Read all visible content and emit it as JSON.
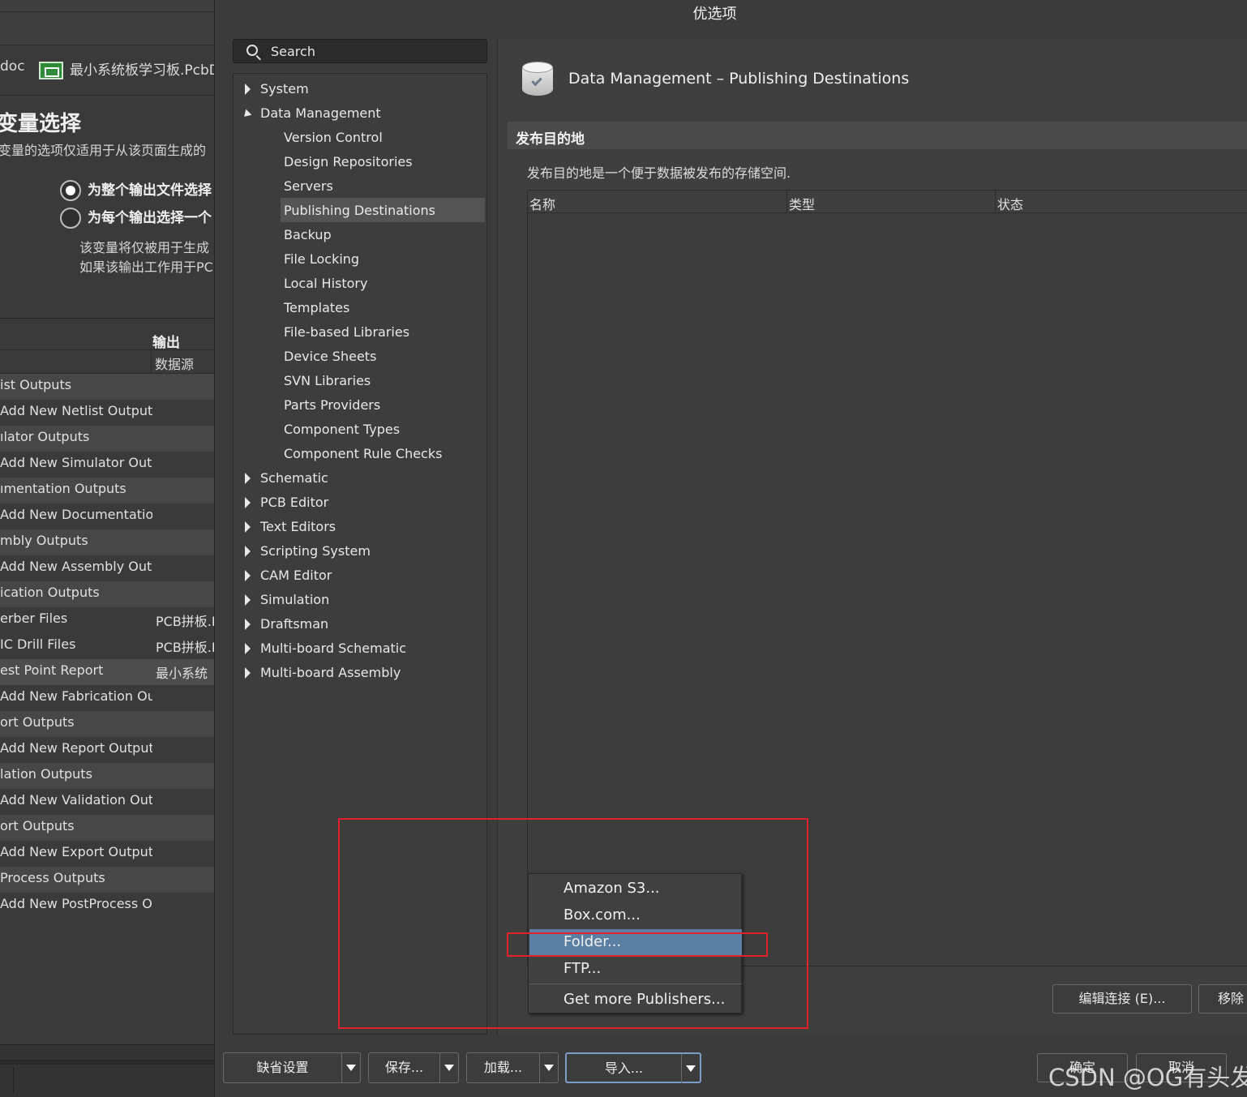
{
  "background_window": {
    "doc_tab_partial": "doc",
    "doc_tab_pcb": "最小系统板学习板.PcbD",
    "heading": "变量选择",
    "description": "变量的选项仅适用于从该页面生成的",
    "radio_whole": "为整个输出文件选择",
    "radio_each": "为每个输出选择一个",
    "note_line1": "该变量将仅被用于生成",
    "note_line2": "如果该输出工作用于PC",
    "column_output": "输出",
    "column_source": "数据源",
    "rows": [
      {
        "label": "ist Outputs",
        "source": ""
      },
      {
        "label": "Add New Netlist Output]",
        "source": ""
      },
      {
        "label": "ılator Outputs",
        "source": ""
      },
      {
        "label": "Add New Simulator Outp",
        "source": ""
      },
      {
        "label": "ımentation Outputs",
        "source": ""
      },
      {
        "label": "Add New Documentation",
        "source": ""
      },
      {
        "label": "mbly Outputs",
        "source": ""
      },
      {
        "label": "Add New Assembly Outpı",
        "source": ""
      },
      {
        "label": "ication Outputs",
        "source": ""
      },
      {
        "label": "erber Files",
        "source": "PCB拼板.I"
      },
      {
        "label": "IC Drill Files",
        "source": "PCB拼板.I"
      },
      {
        "label": "est Point Report",
        "source": "最小系统"
      },
      {
        "label": "Add New Fabrication Out",
        "source": ""
      },
      {
        "label": "ort Outputs",
        "source": ""
      },
      {
        "label": "Add New Report Output]",
        "source": ""
      },
      {
        "label": "lation Outputs",
        "source": ""
      },
      {
        "label": "Add New Validation Outp",
        "source": ""
      },
      {
        "label": "ort Outputs",
        "source": ""
      },
      {
        "label": "Add New Export Output]",
        "source": ""
      },
      {
        "label": "Process Outputs",
        "source": ""
      },
      {
        "label": "Add New PostProcess Ou",
        "source": ""
      }
    ]
  },
  "dialog": {
    "title": "优选项",
    "search": {
      "placeholder": "Search"
    },
    "tree": [
      {
        "label": "System",
        "level": 0,
        "state": "collapsed"
      },
      {
        "label": "Data Management",
        "level": 0,
        "state": "expanded"
      },
      {
        "label": "Version Control",
        "level": 1
      },
      {
        "label": "Design Repositories",
        "level": 1
      },
      {
        "label": "Servers",
        "level": 1
      },
      {
        "label": "Publishing Destinations",
        "level": 1,
        "selected": true
      },
      {
        "label": "Backup",
        "level": 1
      },
      {
        "label": "File Locking",
        "level": 1
      },
      {
        "label": "Local History",
        "level": 1
      },
      {
        "label": "Templates",
        "level": 1
      },
      {
        "label": "File-based Libraries",
        "level": 1
      },
      {
        "label": "Device Sheets",
        "level": 1
      },
      {
        "label": "SVN Libraries",
        "level": 1
      },
      {
        "label": "Parts Providers",
        "level": 1
      },
      {
        "label": "Component Types",
        "level": 1
      },
      {
        "label": "Component Rule Checks",
        "level": 1
      },
      {
        "label": "Schematic",
        "level": 0,
        "state": "collapsed"
      },
      {
        "label": "PCB Editor",
        "level": 0,
        "state": "collapsed"
      },
      {
        "label": "Text Editors",
        "level": 0,
        "state": "collapsed"
      },
      {
        "label": "Scripting System",
        "level": 0,
        "state": "collapsed"
      },
      {
        "label": "CAM Editor",
        "level": 0,
        "state": "collapsed"
      },
      {
        "label": "Simulation",
        "level": 0,
        "state": "collapsed"
      },
      {
        "label": "Draftsman",
        "level": 0,
        "state": "collapsed"
      },
      {
        "label": "Multi-board Schematic",
        "level": 0,
        "state": "collapsed"
      },
      {
        "label": "Multi-board Assembly",
        "level": 0,
        "state": "collapsed"
      }
    ],
    "page_title": "Data Management – Publishing Destinations",
    "section_title": "发布目的地",
    "section_desc": "发布目的地是一个便于数据被发布的存储空间.",
    "table_headers": {
      "name": "名称",
      "type": "类型",
      "status": "状态"
    },
    "import_menu": [
      {
        "label": "Amazon S3...",
        "highlighted": false
      },
      {
        "label": "Box.com...",
        "highlighted": false
      },
      {
        "label": "Folder...",
        "highlighted": true
      },
      {
        "label": "FTP...",
        "highlighted": false
      },
      {
        "label": "Get more Publishers...",
        "highlighted": false
      }
    ],
    "edit_connection_button": "编辑连接 (E)...",
    "remove_button": "移除",
    "bottom_buttons": {
      "defaults": "缺省设置",
      "save": "保存...",
      "load": "加载...",
      "import": "导入...",
      "ok": "确定",
      "cancel": "取消"
    }
  },
  "watermark": "CSDN @OG有头发",
  "colors": {
    "highlight": "#5b7ea3",
    "annotation_red": "#e0232a",
    "panel_bg": "#3d3d3d"
  }
}
